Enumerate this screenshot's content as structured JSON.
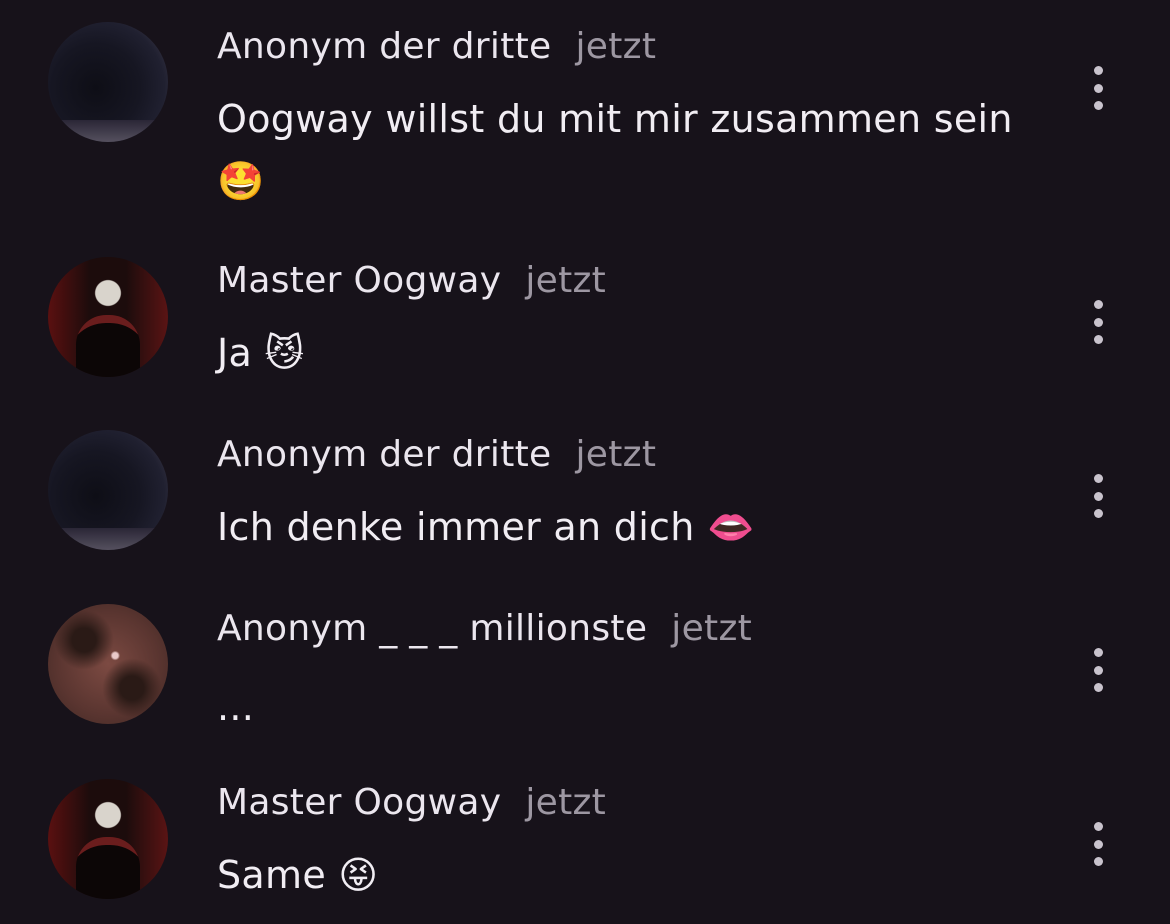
{
  "comments": [
    {
      "author": "Anonym der dritte",
      "time": "jetzt",
      "message": "Oogway willst du mit mir zusammen sein 🤩",
      "avatar": "black-cat-avatar"
    },
    {
      "author": "Master Oogway",
      "time": "jetzt",
      "message": "Ja 😼",
      "avatar": "person-avatar"
    },
    {
      "author": "Anonym der dritte",
      "time": "jetzt",
      "message": "Ich denke immer an dich 👄",
      "avatar": "black-cat-avatar"
    },
    {
      "author": "Anonym _ _ _ millionste",
      "time": "jetzt",
      "message": "...",
      "avatar": "tree-avatar"
    },
    {
      "author": "Master Oogway",
      "time": "jetzt",
      "message": "Same 😝",
      "avatar": "person-avatar"
    }
  ],
  "icons": {
    "more": "more-vertical-icon"
  },
  "colors": {
    "background": "#17121a",
    "author": "#ebe6ee",
    "timestamp": "#9d97a2",
    "message": "#f1edf3",
    "more_icon": "#c9c3cd"
  }
}
